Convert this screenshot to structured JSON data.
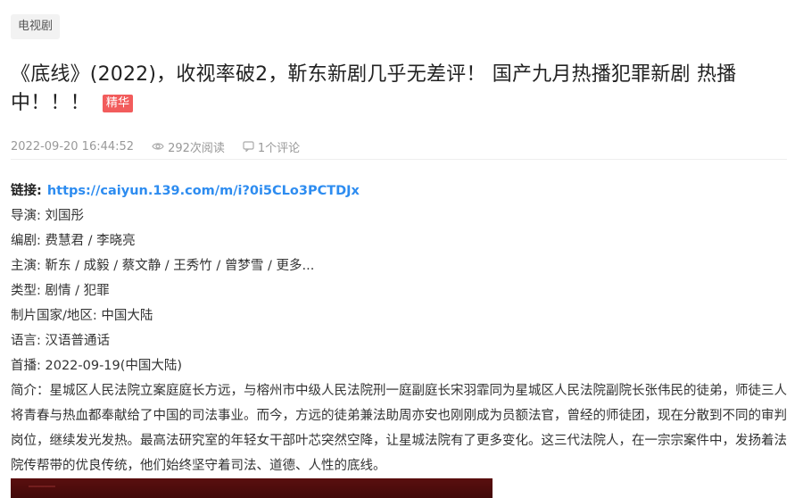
{
  "category": "电视剧",
  "title": "《底线》(2022)，收视率破2，靳东新剧几乎无差评！ 国产九月热播犯罪新剧 热播中！！！",
  "badge": "精华",
  "meta": {
    "datetime": "2022-09-20 16:44:52",
    "views": "292次阅读",
    "comments": "1个评论"
  },
  "info": {
    "link_label": "链接:",
    "link_url": "https://caiyun.139.com/m/i?0i5CLo3PCTDJx",
    "director": "导演: 刘国彤",
    "writer": "编剧: 费慧君 / 李晓亮",
    "cast": "主演: 靳东 / 成毅 / 蔡文静 / 王秀竹 / 曾梦雪 / 更多...",
    "genre": "类型: 剧情 / 犯罪",
    "country": "制片国家/地区: 中国大陆",
    "language": "语言: 汉语普通话",
    "premiere": "首播: 2022-09-19(中国大陆)",
    "synopsis": "简介：星城区人民法院立案庭庭长方远，与榕州市中级人民法院刑一庭副庭长宋羽霏同为星城区人民法院副院长张伟民的徒弟，师徒三人将青春与热血都奉献给了中国的司法事业。而今，方远的徒弟兼法助周亦安也刚刚成为员额法官，曾经的师徒团，现在分散到不同的审判岗位，继续发光发热。最高法研究室的年轻女干部叶芯突然空降，让星城法院有了更多变化。这三代法院人，在一宗宗案件中，发扬着法院传帮带的优良传统，他们始终坚守着司法、道德、人性的底线。"
  },
  "colors": {
    "link": "#2d8cf0",
    "badge": "#f25c5c",
    "meta": "#999999"
  }
}
